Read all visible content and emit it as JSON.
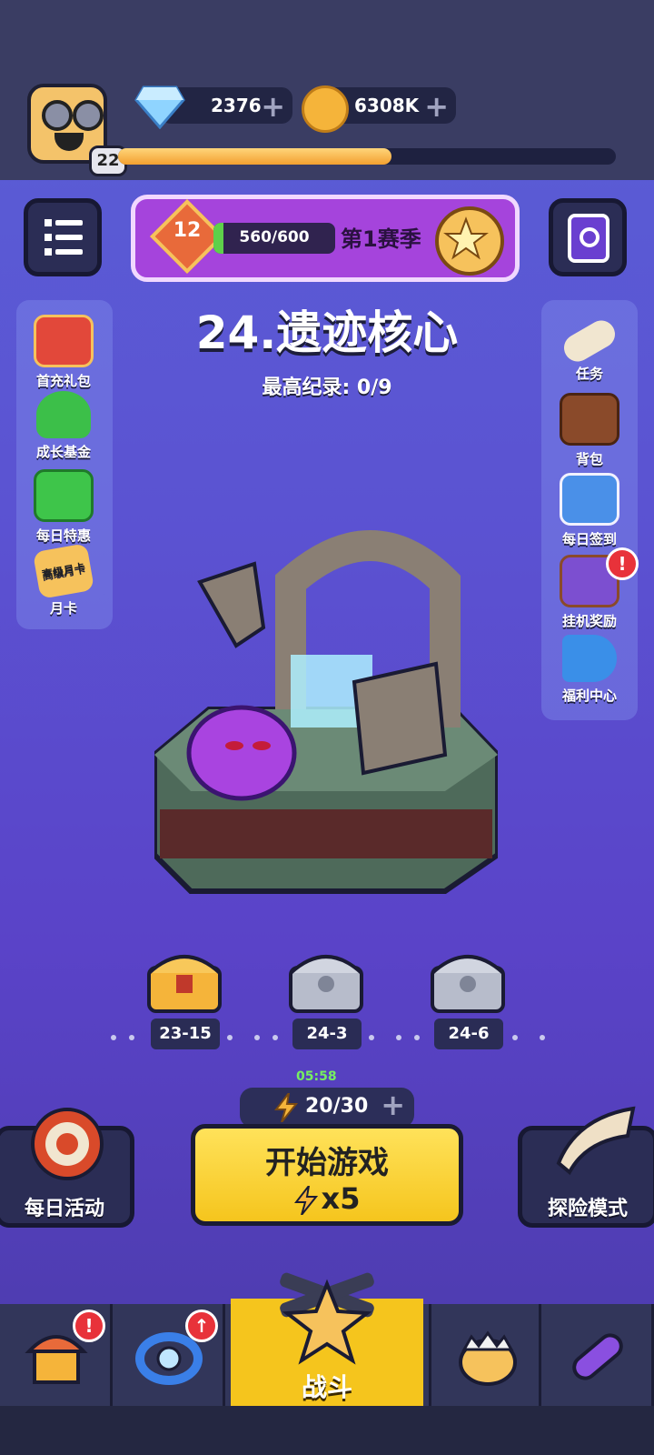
{
  "header": {
    "player_level": "22",
    "gems": "2376",
    "gold": "6308K",
    "xp_progress": 0.55
  },
  "season": {
    "level": "12",
    "progress_text": "560/600",
    "label": "第1赛季"
  },
  "stage": {
    "title": "24.遗迹核心",
    "record": "最高纪录: 0/9"
  },
  "left_menu": [
    {
      "label": "首充礼包",
      "icon": "gift-icon"
    },
    {
      "label": "成长基金",
      "icon": "growth-fund-icon"
    },
    {
      "label": "每日特惠",
      "icon": "basket-icon"
    },
    {
      "label": "月卡",
      "icon": "monthly-card-icon",
      "card_text": "高级月卡"
    }
  ],
  "right_menu": [
    {
      "label": "任务",
      "icon": "scroll-icon"
    },
    {
      "label": "背包",
      "icon": "backpack-icon"
    },
    {
      "label": "每日签到",
      "icon": "clipboard-icon"
    },
    {
      "label": "挂机奖励",
      "icon": "hourglass-icon",
      "badge": "!"
    },
    {
      "label": "福利中心",
      "icon": "megaphone-icon"
    }
  ],
  "chests": [
    {
      "label": "23-15",
      "type": "gold"
    },
    {
      "label": "24-3",
      "type": "silver"
    },
    {
      "label": "24-6",
      "type": "silver"
    }
  ],
  "energy": {
    "timer": "05:58",
    "value": "20/30"
  },
  "actions": {
    "daily_activity": "每日活动",
    "start_game": "开始游戏",
    "start_cost": "x5",
    "adventure_mode": "探险模式"
  },
  "nav": {
    "battle": "战斗",
    "badge_home": "!",
    "badge_ring": "↑"
  },
  "colors": {
    "accent_yellow": "#f5c51d",
    "season_purple": "#a544dc",
    "background": "#5a4fd0"
  }
}
